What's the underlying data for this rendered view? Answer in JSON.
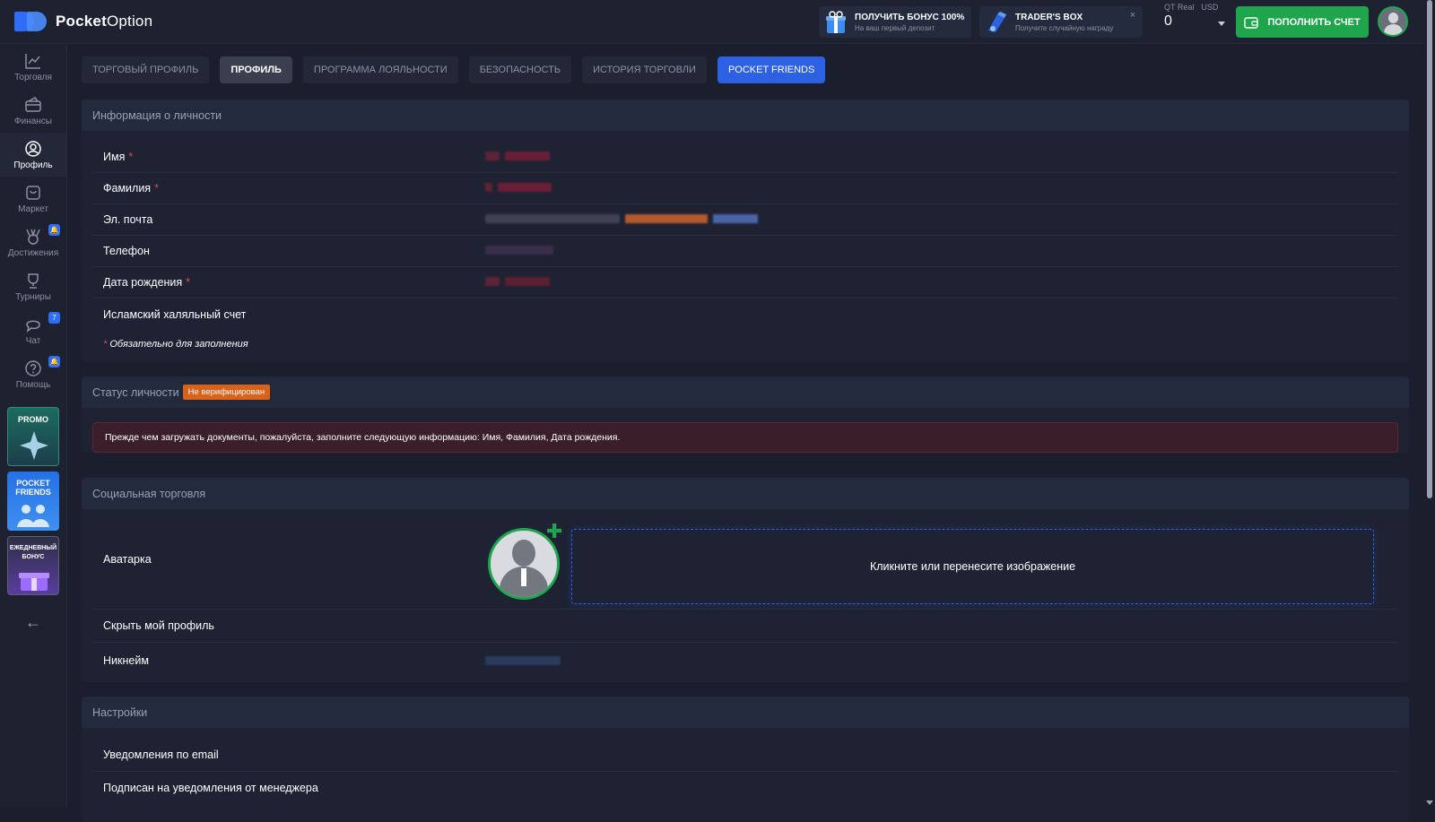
{
  "brand": {
    "name_bold": "Pocket",
    "name_rest": "Option"
  },
  "header": {
    "bonus": {
      "title": "ПОЛУЧИТЬ БОНУС 100%",
      "subtitle": "На ваш первый депозит",
      "icon": "gift-icon"
    },
    "traders_box": {
      "title": "TRADER'S BOX",
      "subtitle": "Получите случайную награду",
      "close": "×",
      "icon": "box-icon"
    },
    "account": {
      "type": "QT Real",
      "currency": "USD",
      "balance": "0"
    },
    "deposit_label": "ПОПОЛНИТЬ СЧЕТ"
  },
  "sidebar": {
    "items": [
      {
        "label": "Торговля",
        "icon": "chart-icon"
      },
      {
        "label": "Финансы",
        "icon": "wallet-icon"
      },
      {
        "label": "Профиль",
        "icon": "profile-icon",
        "active": true
      },
      {
        "label": "Маркет",
        "icon": "cart-icon"
      },
      {
        "label": "Достижения",
        "icon": "medal-icon",
        "badge": "🔔"
      },
      {
        "label": "Турниры",
        "icon": "trophy-icon"
      },
      {
        "label": "Чат",
        "icon": "chat-icon",
        "badge": "7"
      },
      {
        "label": "Помощь",
        "icon": "help-icon",
        "badge": "🔔"
      }
    ],
    "banners": {
      "promo": "PROMO",
      "friends": "POCKET FRIENDS",
      "daily": "ЕЖЕДНЕВНЫЙ БОНУС"
    },
    "collapse": "←"
  },
  "tabs": [
    "ТОРГОВЫЙ ПРОФИЛЬ",
    "ПРОФИЛЬ",
    "ПРОГРАММА ЛОЯЛЬНОСТИ",
    "БЕЗОПАСНОСТЬ",
    "ИСТОРИЯ ТОРГОВЛИ",
    "POCKET FRIENDS"
  ],
  "personal": {
    "title": "Информация о личности",
    "fields": [
      {
        "label": "Имя",
        "required": "*"
      },
      {
        "label": "Фамилия",
        "required": "*"
      },
      {
        "label": "Эл. почта",
        "required": ""
      },
      {
        "label": "Телефон",
        "required": ""
      },
      {
        "label": "Дата рождения",
        "required": "*"
      },
      {
        "label": "Исламский халяльный счет",
        "required": ""
      }
    ],
    "note_mark": "*",
    "note": "Обязательно для заполнения"
  },
  "status": {
    "title": "Статус личности",
    "badge": "Не верифицирован",
    "alert": "Прежде чем загружать документы, пожалуйста, заполните следующую информацию: Имя, Фамилия, Дата рождения."
  },
  "social": {
    "title": "Социальная торговля",
    "avatar_label": "Аватарка",
    "dropzone": "Кликните или перенесите изображение",
    "hide_profile": "Скрыть мой профиль",
    "nickname": "Никнейм"
  },
  "settings": {
    "title": "Настройки",
    "email_notifications": "Уведомления по email",
    "manager_notifications": "Подписан на уведомления от менеджера"
  },
  "colors": {
    "accent": "#2c61e4",
    "success": "#1fa64c",
    "warning": "#d8621a",
    "danger": "#e0464e"
  }
}
